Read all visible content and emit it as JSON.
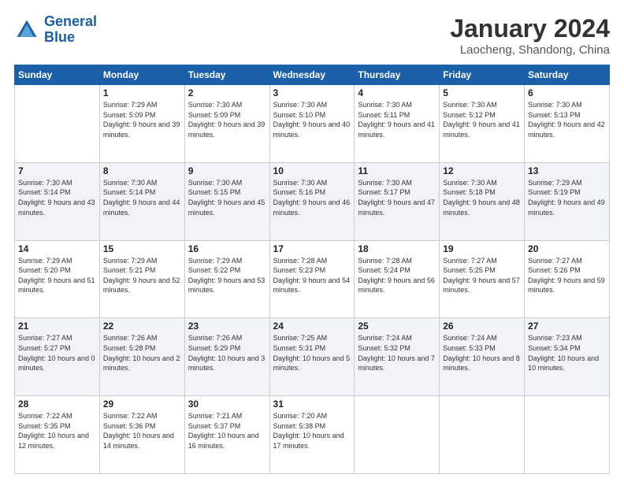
{
  "logo": {
    "line1": "General",
    "line2": "Blue"
  },
  "title": "January 2024",
  "subtitle": "Laocheng, Shandong, China",
  "weekdays": [
    "Sunday",
    "Monday",
    "Tuesday",
    "Wednesday",
    "Thursday",
    "Friday",
    "Saturday"
  ],
  "weeks": [
    [
      {
        "day": "",
        "sunrise": "",
        "sunset": "",
        "daylight": ""
      },
      {
        "day": "1",
        "sunrise": "Sunrise: 7:29 AM",
        "sunset": "Sunset: 5:09 PM",
        "daylight": "Daylight: 9 hours and 39 minutes."
      },
      {
        "day": "2",
        "sunrise": "Sunrise: 7:30 AM",
        "sunset": "Sunset: 5:09 PM",
        "daylight": "Daylight: 9 hours and 39 minutes."
      },
      {
        "day": "3",
        "sunrise": "Sunrise: 7:30 AM",
        "sunset": "Sunset: 5:10 PM",
        "daylight": "Daylight: 9 hours and 40 minutes."
      },
      {
        "day": "4",
        "sunrise": "Sunrise: 7:30 AM",
        "sunset": "Sunset: 5:11 PM",
        "daylight": "Daylight: 9 hours and 41 minutes."
      },
      {
        "day": "5",
        "sunrise": "Sunrise: 7:30 AM",
        "sunset": "Sunset: 5:12 PM",
        "daylight": "Daylight: 9 hours and 41 minutes."
      },
      {
        "day": "6",
        "sunrise": "Sunrise: 7:30 AM",
        "sunset": "Sunset: 5:13 PM",
        "daylight": "Daylight: 9 hours and 42 minutes."
      }
    ],
    [
      {
        "day": "7",
        "sunrise": "Sunrise: 7:30 AM",
        "sunset": "Sunset: 5:14 PM",
        "daylight": "Daylight: 9 hours and 43 minutes."
      },
      {
        "day": "8",
        "sunrise": "Sunrise: 7:30 AM",
        "sunset": "Sunset: 5:14 PM",
        "daylight": "Daylight: 9 hours and 44 minutes."
      },
      {
        "day": "9",
        "sunrise": "Sunrise: 7:30 AM",
        "sunset": "Sunset: 5:15 PM",
        "daylight": "Daylight: 9 hours and 45 minutes."
      },
      {
        "day": "10",
        "sunrise": "Sunrise: 7:30 AM",
        "sunset": "Sunset: 5:16 PM",
        "daylight": "Daylight: 9 hours and 46 minutes."
      },
      {
        "day": "11",
        "sunrise": "Sunrise: 7:30 AM",
        "sunset": "Sunset: 5:17 PM",
        "daylight": "Daylight: 9 hours and 47 minutes."
      },
      {
        "day": "12",
        "sunrise": "Sunrise: 7:30 AM",
        "sunset": "Sunset: 5:18 PM",
        "daylight": "Daylight: 9 hours and 48 minutes."
      },
      {
        "day": "13",
        "sunrise": "Sunrise: 7:29 AM",
        "sunset": "Sunset: 5:19 PM",
        "daylight": "Daylight: 9 hours and 49 minutes."
      }
    ],
    [
      {
        "day": "14",
        "sunrise": "Sunrise: 7:29 AM",
        "sunset": "Sunset: 5:20 PM",
        "daylight": "Daylight: 9 hours and 51 minutes."
      },
      {
        "day": "15",
        "sunrise": "Sunrise: 7:29 AM",
        "sunset": "Sunset: 5:21 PM",
        "daylight": "Daylight: 9 hours and 52 minutes."
      },
      {
        "day": "16",
        "sunrise": "Sunrise: 7:29 AM",
        "sunset": "Sunset: 5:22 PM",
        "daylight": "Daylight: 9 hours and 53 minutes."
      },
      {
        "day": "17",
        "sunrise": "Sunrise: 7:28 AM",
        "sunset": "Sunset: 5:23 PM",
        "daylight": "Daylight: 9 hours and 54 minutes."
      },
      {
        "day": "18",
        "sunrise": "Sunrise: 7:28 AM",
        "sunset": "Sunset: 5:24 PM",
        "daylight": "Daylight: 9 hours and 56 minutes."
      },
      {
        "day": "19",
        "sunrise": "Sunrise: 7:27 AM",
        "sunset": "Sunset: 5:25 PM",
        "daylight": "Daylight: 9 hours and 57 minutes."
      },
      {
        "day": "20",
        "sunrise": "Sunrise: 7:27 AM",
        "sunset": "Sunset: 5:26 PM",
        "daylight": "Daylight: 9 hours and 59 minutes."
      }
    ],
    [
      {
        "day": "21",
        "sunrise": "Sunrise: 7:27 AM",
        "sunset": "Sunset: 5:27 PM",
        "daylight": "Daylight: 10 hours and 0 minutes."
      },
      {
        "day": "22",
        "sunrise": "Sunrise: 7:26 AM",
        "sunset": "Sunset: 5:28 PM",
        "daylight": "Daylight: 10 hours and 2 minutes."
      },
      {
        "day": "23",
        "sunrise": "Sunrise: 7:26 AM",
        "sunset": "Sunset: 5:29 PM",
        "daylight": "Daylight: 10 hours and 3 minutes."
      },
      {
        "day": "24",
        "sunrise": "Sunrise: 7:25 AM",
        "sunset": "Sunset: 5:31 PM",
        "daylight": "Daylight: 10 hours and 5 minutes."
      },
      {
        "day": "25",
        "sunrise": "Sunrise: 7:24 AM",
        "sunset": "Sunset: 5:32 PM",
        "daylight": "Daylight: 10 hours and 7 minutes."
      },
      {
        "day": "26",
        "sunrise": "Sunrise: 7:24 AM",
        "sunset": "Sunset: 5:33 PM",
        "daylight": "Daylight: 10 hours and 8 minutes."
      },
      {
        "day": "27",
        "sunrise": "Sunrise: 7:23 AM",
        "sunset": "Sunset: 5:34 PM",
        "daylight": "Daylight: 10 hours and 10 minutes."
      }
    ],
    [
      {
        "day": "28",
        "sunrise": "Sunrise: 7:22 AM",
        "sunset": "Sunset: 5:35 PM",
        "daylight": "Daylight: 10 hours and 12 minutes."
      },
      {
        "day": "29",
        "sunrise": "Sunrise: 7:22 AM",
        "sunset": "Sunset: 5:36 PM",
        "daylight": "Daylight: 10 hours and 14 minutes."
      },
      {
        "day": "30",
        "sunrise": "Sunrise: 7:21 AM",
        "sunset": "Sunset: 5:37 PM",
        "daylight": "Daylight: 10 hours and 16 minutes."
      },
      {
        "day": "31",
        "sunrise": "Sunrise: 7:20 AM",
        "sunset": "Sunset: 5:38 PM",
        "daylight": "Daylight: 10 hours and 17 minutes."
      },
      {
        "day": "",
        "sunrise": "",
        "sunset": "",
        "daylight": ""
      },
      {
        "day": "",
        "sunrise": "",
        "sunset": "",
        "daylight": ""
      },
      {
        "day": "",
        "sunrise": "",
        "sunset": "",
        "daylight": ""
      }
    ]
  ]
}
